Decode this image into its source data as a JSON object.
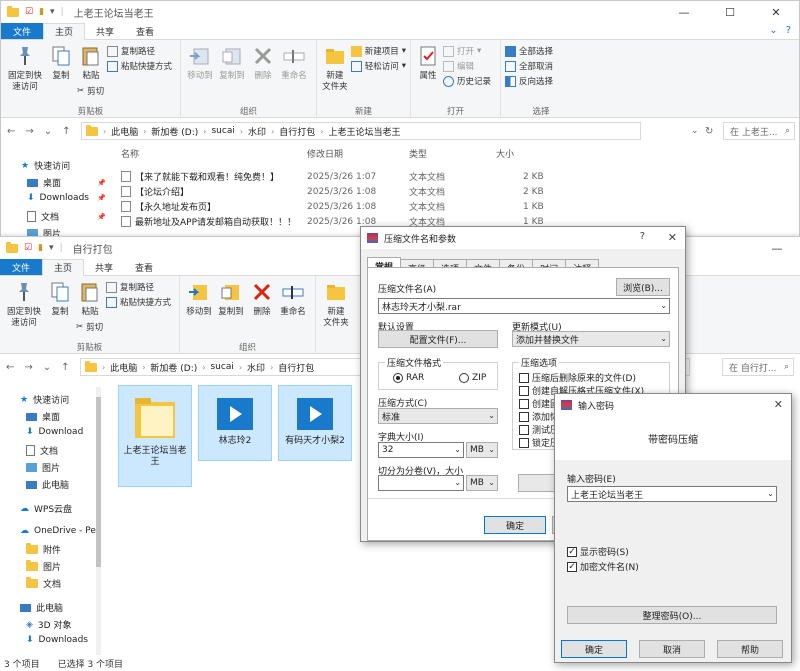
{
  "w1": {
    "title": "上老王论坛当老王",
    "tabs": {
      "file": "文件",
      "home": "主页",
      "share": "共享",
      "view": "查看"
    },
    "ribbon": {
      "pin": "固定到快\n速访问",
      "copy": "复制",
      "paste": "粘贴",
      "copy_path": "复制路径",
      "paste_shortcut": "粘贴快捷方式",
      "cut": "剪切",
      "clipboard": "剪贴板",
      "move_to": "移动到",
      "copy_to": "复制到",
      "delete": "删除",
      "rename": "重命名",
      "organize": "组织",
      "new_folder": "新建\n文件夹",
      "new_item": "新建项目",
      "easy_access": "轻松访问",
      "new_group": "新建",
      "properties": "属性",
      "open": "打开",
      "edit": "编辑",
      "history": "历史记录",
      "open_group": "打开",
      "select_all": "全部选择",
      "select_none": "全部取消",
      "invert": "反向选择",
      "select_group": "选择"
    },
    "path": [
      "此电脑",
      "新加卷 (D:)",
      "sucai",
      "水印",
      "自行打包",
      "上老王论坛当老王"
    ],
    "search": "在 上老王...",
    "headers": {
      "name": "名称",
      "date": "修改日期",
      "type": "类型",
      "size": "大小"
    },
    "files": [
      {
        "name": "【来了就能下载和观看！纯免费！】",
        "date": "2025/3/26 1:07",
        "type": "文本文档",
        "size": "2 KB"
      },
      {
        "name": "【论坛介绍】",
        "date": "2025/3/26 1:08",
        "type": "文本文档",
        "size": "2 KB"
      },
      {
        "name": "【永久地址发布页】",
        "date": "2025/3/26 1:08",
        "type": "文本文档",
        "size": "1 KB"
      },
      {
        "name": "最新地址及APP请发邮箱自动获取！！！",
        "date": "2025/3/26 1:08",
        "type": "文本文档",
        "size": "1 KB"
      }
    ],
    "nav": {
      "quick": "快速访问",
      "desktop": "桌面",
      "downloads": "Downloads",
      "docs": "文档",
      "pics": "图片"
    }
  },
  "w2": {
    "title": "自行打包",
    "path": [
      "此电脑",
      "新加卷 (D:)",
      "sucai",
      "水印",
      "自行打包"
    ],
    "search": "在 自行打...",
    "nav": {
      "quick": "快速访问",
      "desktop": "桌面",
      "downloads": "Download",
      "docs": "文档",
      "pics": "图片",
      "pc": "此电脑",
      "wps": "WPS云盘",
      "onedrive": "OneDrive - Pe",
      "att": "附件",
      "pics2": "图片",
      "docs2": "文档",
      "pc2": "此电脑",
      "obj3d": "3D 对象",
      "dl2": "Downloads"
    },
    "items": [
      {
        "name": "上老王论坛当老王"
      },
      {
        "name": "林志玲2"
      },
      {
        "name": "有码天才小梨2"
      }
    ],
    "status": {
      "count": "3 个项目",
      "selected": "已选择 3 个项目"
    }
  },
  "rar": {
    "title": "压缩文件名和参数",
    "tabs": [
      "常规",
      "高级",
      "选项",
      "文件",
      "备份",
      "时间",
      "注释"
    ],
    "archive_label": "压缩文件名(A)",
    "browse": "浏览(B)...",
    "archive_name": "林志玲天才小梨.rar",
    "default_label": "默认设置",
    "profiles": "配置文件(F)...",
    "update_label": "更新模式(U)",
    "update_value": "添加并替换文件",
    "format_label": "压缩文件格式",
    "rar": "RAR",
    "zip": "ZIP",
    "method_label": "压缩方式(C)",
    "method_value": "标准",
    "dict_label": "字典大小(I)",
    "dict_value": "32",
    "dict_unit": "MB",
    "split_label": "切分为分卷(V)，大小",
    "split_unit": "MB",
    "options_label": "压缩选项",
    "options": [
      "压缩后删除原来的文件(D)",
      "创建自解压格式压缩文件(X)",
      "创建固",
      "添加恢",
      "测试压",
      "锁定压"
    ],
    "ok": "确定"
  },
  "pwd": {
    "title": "输入密码",
    "heading": "带密码压缩",
    "enter_label": "输入密码(E)",
    "password": "上老王论坛当老王",
    "show": "显示密码(S)",
    "encrypt": "加密文件名(N)",
    "organize": "整理密码(O)...",
    "ok": "确定",
    "cancel": "取消",
    "help": "帮助"
  },
  "colors": {
    "accent": "#1979ca",
    "select": "#cce8ff",
    "folder": "#f5c542"
  }
}
